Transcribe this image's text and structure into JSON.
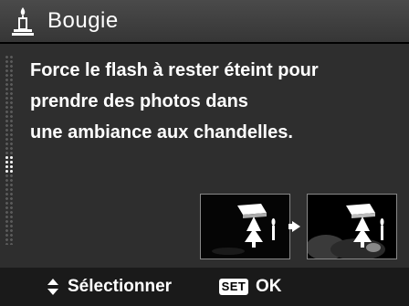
{
  "header": {
    "icon": "candle-icon",
    "title": "Bougie"
  },
  "description": {
    "lines": [
      "Force le flash à rester éteint pour",
      "prendre des photos dans",
      "une ambiance aux chandelles."
    ]
  },
  "preview": {
    "before_icon": "candle-scene-flash-icon",
    "arrow_icon": "arrow-right-icon",
    "after_icon": "candle-scene-ambient-icon"
  },
  "footer": {
    "nav_icon": "up-down-arrows-icon",
    "select_label": "Sélectionner",
    "set_badge": "SET",
    "ok_label": "OK"
  },
  "colors": {
    "background": "#262626",
    "title_bar": "#3f3f3f",
    "text": "#ffffff",
    "scroll_dot": "#5a5a5a",
    "scroll_thumb": "#f0f0f0"
  }
}
